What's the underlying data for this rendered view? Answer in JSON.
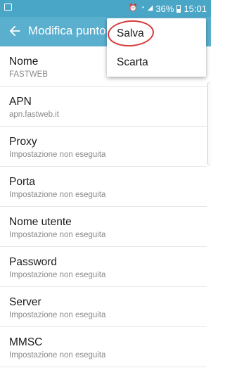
{
  "status_bar": {
    "battery_percent": "36%",
    "time": "15:01",
    "icons": [
      "screenshot-icon",
      "alarm-icon",
      "wifi-icon",
      "signal-icon",
      "battery-icon"
    ]
  },
  "app_bar": {
    "title": "Modifica punto",
    "back_icon": "arrow-left-icon"
  },
  "fields": [
    {
      "label": "Nome",
      "value": "FASTWEB"
    },
    {
      "label": "APN",
      "value": "apn.fastweb.it"
    },
    {
      "label": "Proxy",
      "value": "Impostazione non eseguita"
    },
    {
      "label": "Porta",
      "value": "Impostazione non eseguita"
    },
    {
      "label": "Nome utente",
      "value": "Impostazione non eseguita"
    },
    {
      "label": "Password",
      "value": "Impostazione non eseguita"
    },
    {
      "label": "Server",
      "value": "Impostazione non eseguita"
    },
    {
      "label": "MMSC",
      "value": "Impostazione non eseguita"
    }
  ],
  "menu": {
    "save_label": "Salva",
    "discard_label": "Scarta"
  },
  "colors": {
    "status_bar": "#4aa6c6",
    "app_bar": "#5aafcf",
    "annotation": "#d63a3a"
  }
}
